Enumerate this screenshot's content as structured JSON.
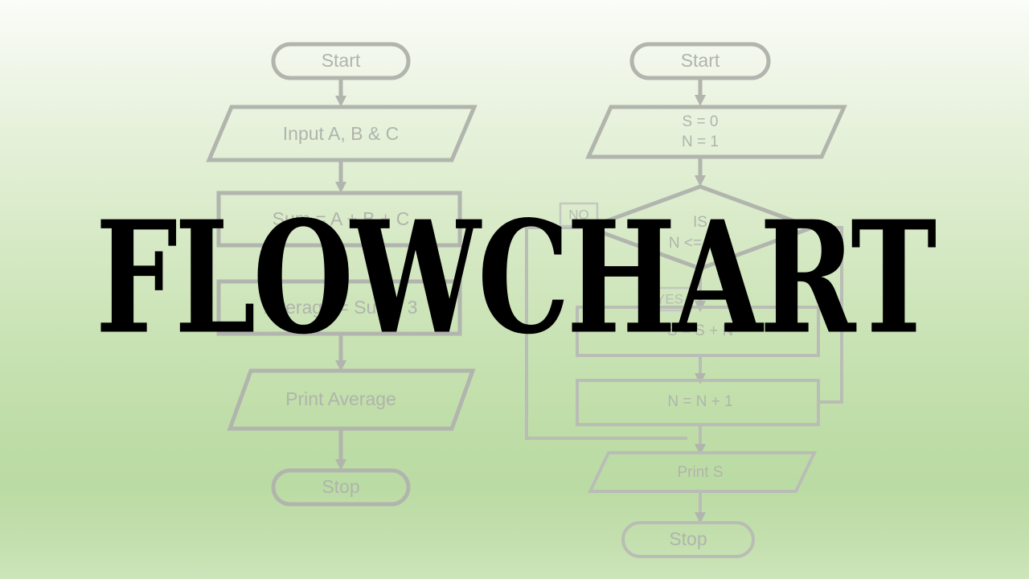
{
  "title": {
    "text": "FLOWCHART",
    "color": "#000000"
  },
  "theme": {
    "background_top": "#fbfdf9",
    "background_bottom": "#cde5ba",
    "shape_stroke": "#b1b5ad",
    "text_color": "#b0b4ac"
  },
  "flowcharts": [
    {
      "id": "average-flowchart",
      "nodes": [
        {
          "id": "start",
          "type": "terminator",
          "label": "Start"
        },
        {
          "id": "input",
          "type": "io",
          "label": "Input A, B & C"
        },
        {
          "id": "sum",
          "type": "process",
          "label": "Sum = A + B + C"
        },
        {
          "id": "average",
          "type": "process",
          "label": "Average = Sum / 3"
        },
        {
          "id": "print",
          "type": "io",
          "label": "Print Average"
        },
        {
          "id": "stop",
          "type": "terminator",
          "label": "Stop"
        }
      ]
    },
    {
      "id": "sum-loop-flowchart",
      "nodes": [
        {
          "id": "start2",
          "type": "terminator",
          "label": "Start"
        },
        {
          "id": "init",
          "type": "io",
          "label_line1": "S = 0",
          "label_line2": "N = 1"
        },
        {
          "id": "decision",
          "type": "decision",
          "label_line1": "IS",
          "label_line2": "N <= 100"
        },
        {
          "id": "accumulate",
          "type": "process",
          "label": "S = S + N"
        },
        {
          "id": "increment",
          "type": "process",
          "label": "N = N + 1"
        },
        {
          "id": "prints",
          "type": "io",
          "label": "Print S"
        },
        {
          "id": "stop2",
          "type": "terminator",
          "label": "Stop"
        }
      ],
      "branch_labels": {
        "no": "NO",
        "yes": "YES"
      }
    }
  ]
}
